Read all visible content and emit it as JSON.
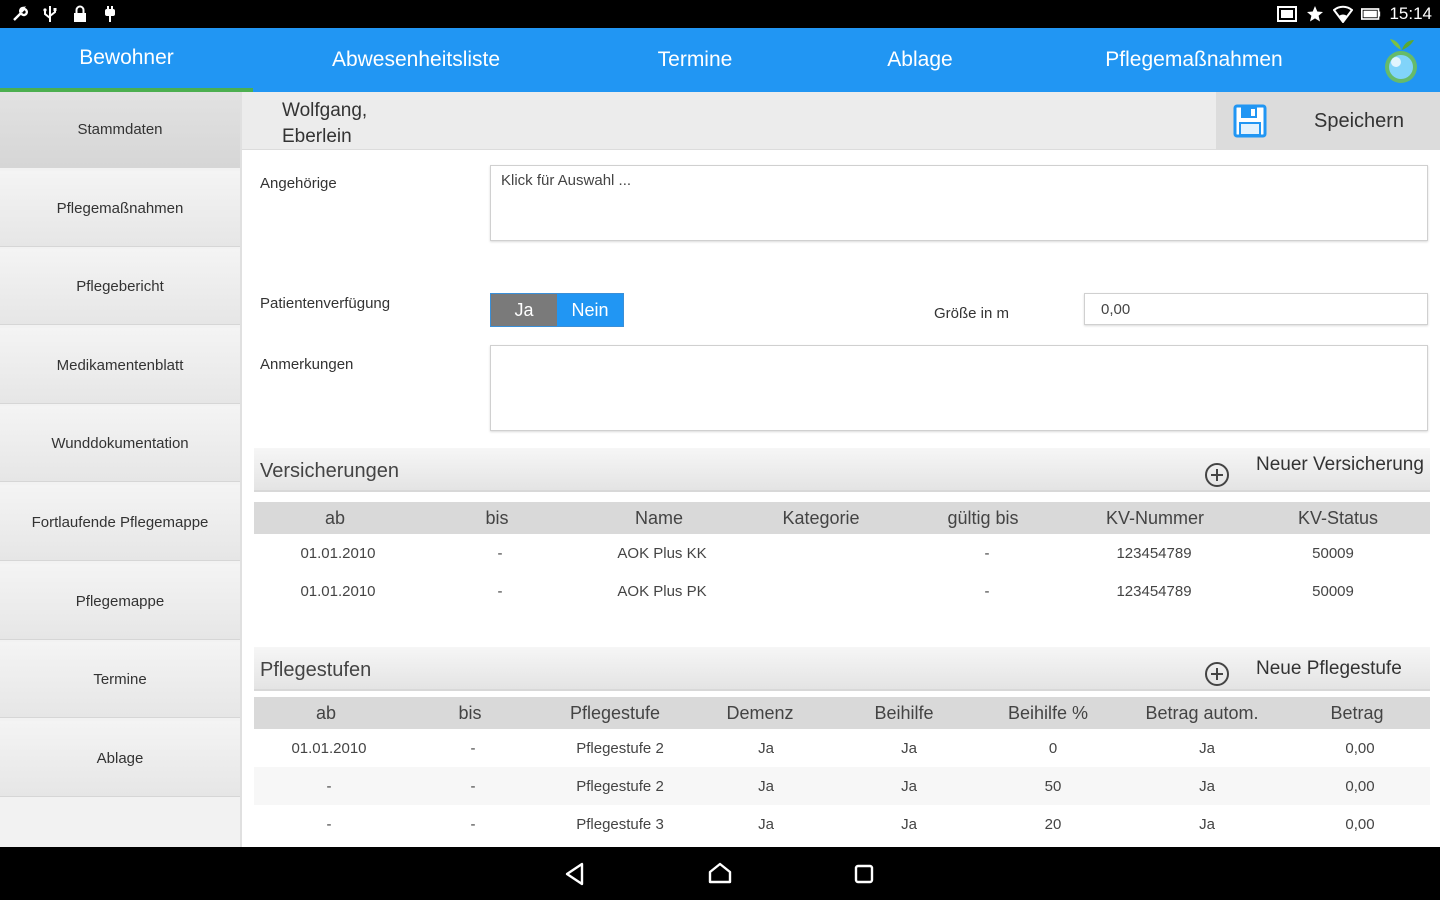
{
  "status_bar": {
    "time": "15:14"
  },
  "nav_tabs": [
    "Bewohner",
    "Abwesenheitsliste",
    "Termine",
    "Ablage",
    "Pflegemaßnahmen"
  ],
  "sidebar": [
    "Stammdaten",
    "Pflegemaßnahmen",
    "Pflegebericht",
    "Medikamentenblatt",
    "Wunddokumentation",
    "Fortlaufende Pflegemappe",
    "Pflegemappe",
    "Termine",
    "Ablage"
  ],
  "header": {
    "name_line1": "Wolfgang,",
    "name_line2": "Eberlein",
    "save_label": "Speichern"
  },
  "form": {
    "relatives_label": "Angehörige",
    "relatives_value": "Klick für Auswahl ...",
    "directive_label": "Patientenverfügung",
    "toggle_yes": "Ja",
    "toggle_no": "Nein",
    "size_label": "Größe in m",
    "size_value": "0,00",
    "notes_label": "Anmerkungen"
  },
  "insurance": {
    "title": "Versicherungen",
    "add_label": "Neuer Versicherung",
    "columns": [
      "ab",
      "bis",
      "Name",
      "Kategorie",
      "gültig bis",
      "KV-Nummer",
      "KV-Status"
    ],
    "rows": [
      [
        "01.01.2010",
        "-",
        "AOK Plus KK",
        "",
        "-",
        "123454789",
        "50009"
      ],
      [
        "01.01.2010",
        "-",
        "AOK Plus PK",
        "",
        "-",
        "123454789",
        "50009"
      ]
    ]
  },
  "care_levels": {
    "title": "Pflegestufen",
    "add_label": "Neue Pflegestufe",
    "columns": [
      "ab",
      "bis",
      "Pflegestufe",
      "Demenz",
      "Beihilfe",
      "Beihilfe %",
      "Betrag autom.",
      "Betrag"
    ],
    "rows": [
      [
        "01.01.2010",
        "-",
        "Pflegestufe 2",
        "Ja",
        "Ja",
        "0",
        "Ja",
        "0,00"
      ],
      [
        "-",
        "-",
        "Pflegestufe 2",
        "Ja",
        "Ja",
        "50",
        "Ja",
        "0,00"
      ],
      [
        "-",
        "-",
        "Pflegestufe 3",
        "Ja",
        "Ja",
        "20",
        "Ja",
        "0,00"
      ]
    ]
  },
  "colors": {
    "accent": "#2196f3",
    "active_tab_indicator": "#4caf50"
  }
}
